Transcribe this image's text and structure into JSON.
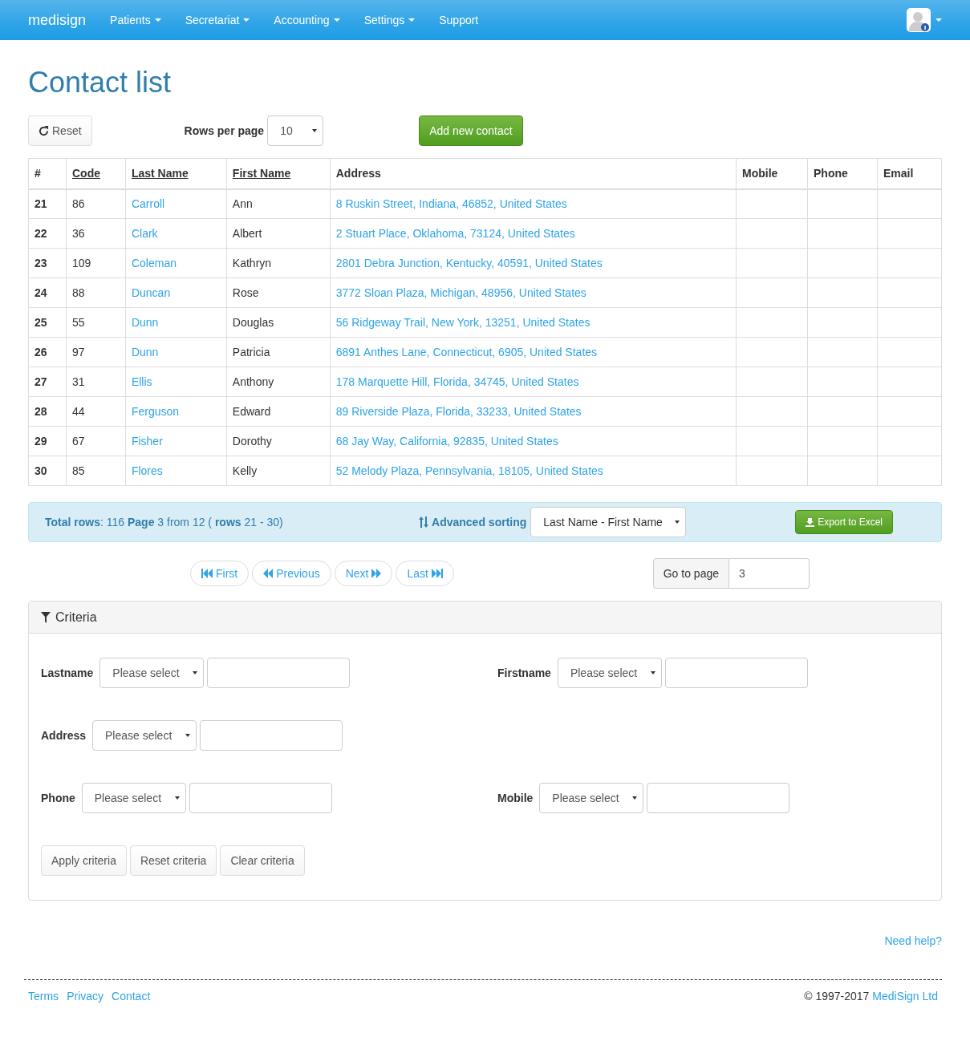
{
  "navbar": {
    "brand": "medisign",
    "menu": [
      {
        "label": "Patients",
        "dropdown": true
      },
      {
        "label": "Secretariat",
        "dropdown": true
      },
      {
        "label": "Accounting",
        "dropdown": true
      },
      {
        "label": "Settings",
        "dropdown": true
      },
      {
        "label": "Support",
        "dropdown": false
      }
    ]
  },
  "title": "Contact list",
  "toolbar": {
    "reset": "Reset",
    "rows_label": "Rows per page",
    "rows_value": "10",
    "add": "Add new contact"
  },
  "table": {
    "columns": [
      {
        "label": "#",
        "sortable": false
      },
      {
        "label": "Code",
        "sortable": true
      },
      {
        "label": "Last Name",
        "sortable": true
      },
      {
        "label": "First Name",
        "sortable": true
      },
      {
        "label": "Address",
        "sortable": false
      },
      {
        "label": "Mobile",
        "sortable": false
      },
      {
        "label": "Phone",
        "sortable": false
      },
      {
        "label": "Email",
        "sortable": false
      }
    ],
    "rows": [
      {
        "num": "21",
        "code": "86",
        "last": "Carroll",
        "first": "Ann",
        "address": "8 Ruskin Street, Indiana, 46852, United States"
      },
      {
        "num": "22",
        "code": "36",
        "last": "Clark",
        "first": "Albert",
        "address": "2 Stuart Place, Oklahoma, 73124, United States"
      },
      {
        "num": "23",
        "code": "109",
        "last": "Coleman",
        "first": "Kathryn",
        "address": "2801 Debra Junction, Kentucky, 40591, United States"
      },
      {
        "num": "24",
        "code": "88",
        "last": "Duncan",
        "first": "Rose",
        "address": "3772 Sloan Plaza, Michigan, 48956, United States"
      },
      {
        "num": "25",
        "code": "55",
        "last": "Dunn",
        "first": "Douglas",
        "address": "56 Ridgeway Trail, New York, 13251, United States"
      },
      {
        "num": "26",
        "code": "97",
        "last": "Dunn",
        "first": "Patricia",
        "address": "6891 Anthes Lane, Connecticut, 6905, United States"
      },
      {
        "num": "27",
        "code": "31",
        "last": "Ellis",
        "first": "Anthony",
        "address": "178 Marquette Hill, Florida, 34745, United States"
      },
      {
        "num": "28",
        "code": "44",
        "last": "Ferguson",
        "first": "Edward",
        "address": "89 Riverside Plaza, Florida, 33233, United States"
      },
      {
        "num": "29",
        "code": "67",
        "last": "Fisher",
        "first": "Dorothy",
        "address": "68 Jay Way, California, 92835, United States"
      },
      {
        "num": "30",
        "code": "85",
        "last": "Flores",
        "first": "Kelly",
        "address": "52 Melody Plaza, Pennsylvania, 18105, United States"
      }
    ]
  },
  "summary": {
    "text": "**Total rows**: 116 **Page** 3 from 12 ( **rows** 21 - 30)",
    "sort_label": "Advanced sorting",
    "sort_value": "Last Name - First Name",
    "export": "Export to Excel"
  },
  "pager": {
    "buttons": [
      "First",
      "Previous",
      "Next",
      "Last"
    ],
    "goto_label": "Go to page",
    "goto_value": "3"
  },
  "criteria": {
    "title": "Criteria",
    "rows": [
      [
        {
          "label": "Lastname",
          "placeholder": "Please select"
        },
        {
          "label": "Firstname",
          "placeholder": "Please select"
        }
      ],
      [
        {
          "label": "Address",
          "placeholder": "Please select"
        }
      ],
      [
        {
          "label": "Phone",
          "placeholder": "Please select"
        },
        {
          "label": "Mobile",
          "placeholder": "Please select"
        }
      ]
    ],
    "buttons": [
      "Apply criteria",
      "Reset criteria",
      "Clear criteria"
    ]
  },
  "help": "Need help?",
  "footer": {
    "links": [
      "Terms",
      "Privacy",
      "Contact"
    ],
    "copyright": "© 1997-2017",
    "company": "MediSign Ltd"
  }
}
